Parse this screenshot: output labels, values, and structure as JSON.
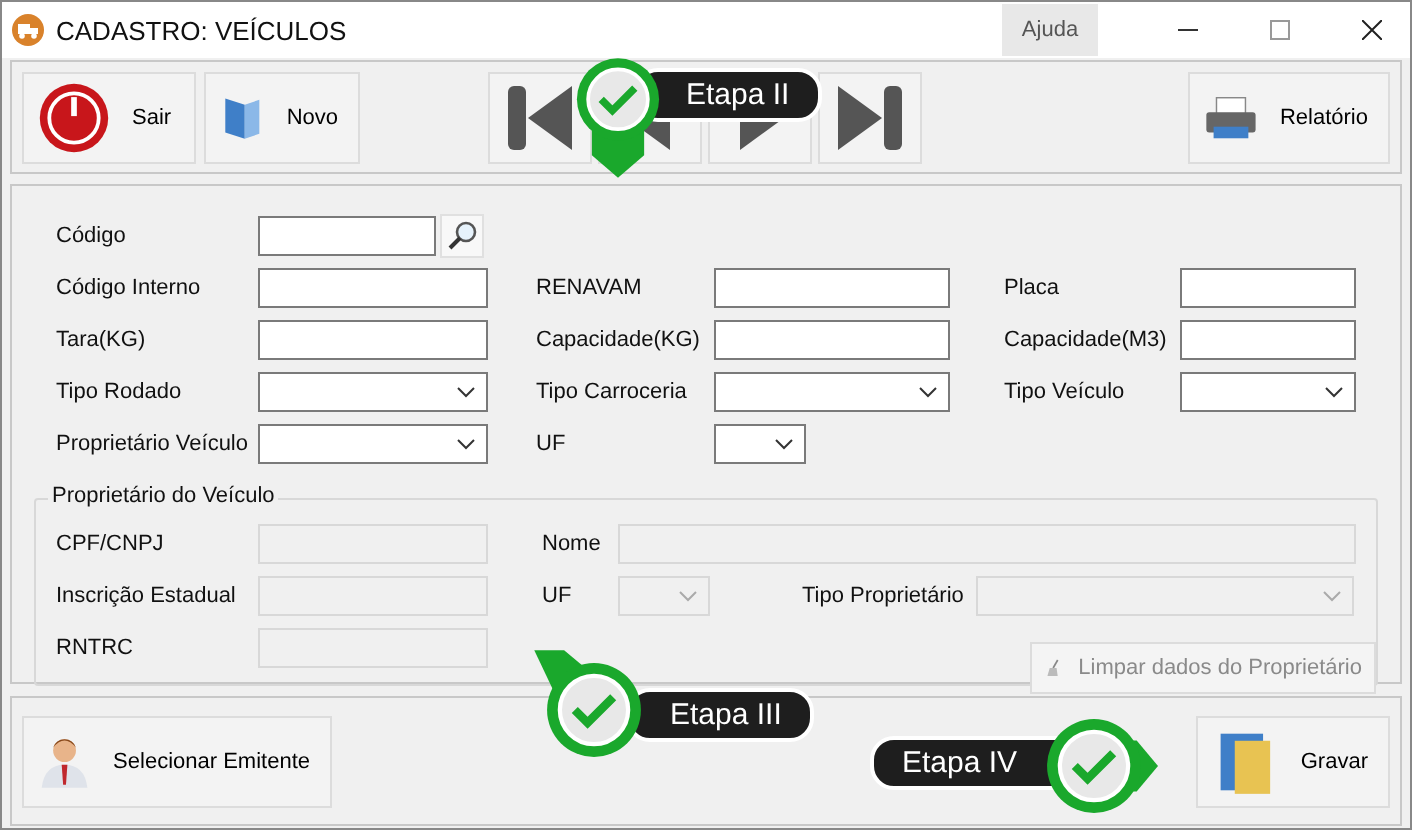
{
  "window": {
    "title": "CADASTRO: VEÍCULOS",
    "help": "Ajuda"
  },
  "toolbar": {
    "left": [
      {
        "label": "Sair",
        "kind": "power"
      },
      {
        "label": "Novo",
        "kind": "folder"
      }
    ],
    "nav": [
      {
        "kind": "first"
      },
      {
        "kind": "prev"
      },
      {
        "kind": "next"
      },
      {
        "kind": "last"
      }
    ],
    "right": [
      {
        "label": "Relatório",
        "kind": "printer"
      }
    ]
  },
  "form": {
    "rows": [
      [
        {
          "label": "Código",
          "kind": "search"
        }
      ],
      [
        {
          "label": "Código Interno",
          "kind": "text"
        },
        {
          "label": "RENAVAM",
          "kind": "text"
        },
        {
          "label": "Placa",
          "kind": "text"
        }
      ],
      [
        {
          "label": "Tara(KG)",
          "kind": "text"
        },
        {
          "label": "Capacidade(KG)",
          "kind": "text"
        },
        {
          "label": "Capacidade(M3)",
          "kind": "text"
        }
      ],
      [
        {
          "label": "Tipo Rodado",
          "kind": "select"
        },
        {
          "label": "Tipo Carroceria",
          "kind": "select"
        },
        {
          "label": "Tipo Veículo",
          "kind": "select"
        }
      ],
      [
        {
          "label": "Proprietário Veículo",
          "kind": "select"
        },
        {
          "label": "UF",
          "kind": "small-select"
        }
      ]
    ]
  },
  "owner": {
    "title": "Proprietário do Veículo",
    "fields": [
      {
        "label": "CPF/CNPJ",
        "kind": "text",
        "disabled": true
      },
      {
        "label": "Nome",
        "kind": "wide-text",
        "disabled": true
      },
      {
        "label": "Inscrição Estadual",
        "kind": "text",
        "disabled": true
      },
      {
        "label": "UF",
        "kind": "small-select",
        "disabled": true
      },
      {
        "label": "Tipo Proprietário",
        "kind": "select",
        "disabled": true
      },
      {
        "label": "RNTRC",
        "kind": "text",
        "disabled": true
      }
    ],
    "clear_button": {
      "label": "Limpar dados do Proprietário",
      "disabled": true
    }
  },
  "footer": {
    "left": {
      "label": "Selecionar Emitente"
    },
    "right": {
      "label": "Gravar"
    }
  },
  "callouts": [
    {
      "label": "Etapa II"
    },
    {
      "label": "Etapa III"
    },
    {
      "label": "Etapa IV"
    }
  ]
}
